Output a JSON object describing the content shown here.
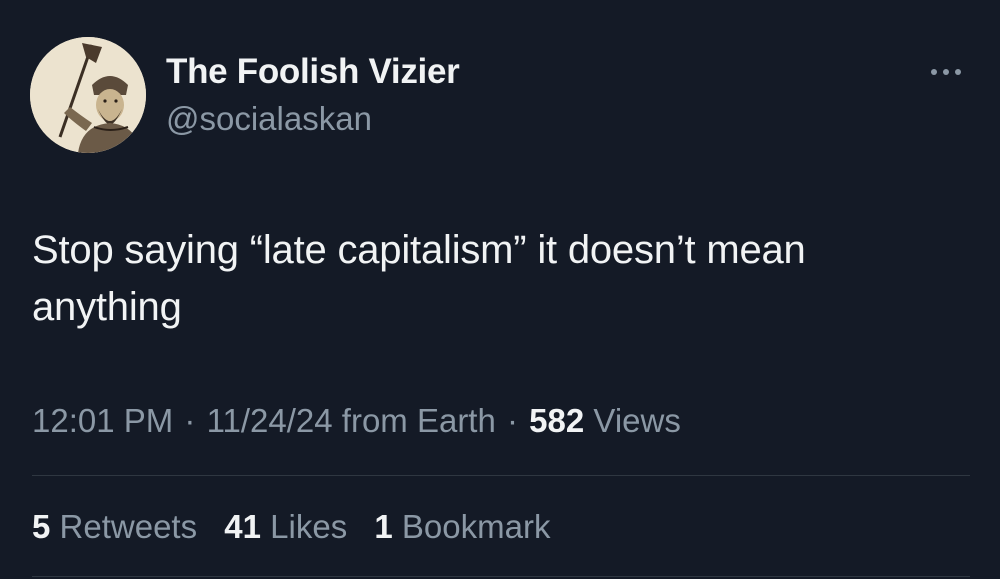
{
  "author": {
    "name": "The Foolish Vizier",
    "handle": "@socialaskan",
    "avatar_icon": "portrait-with-axe"
  },
  "more_icon": "more-horizontal-icon",
  "tweet": {
    "text": "Stop saying “late capitalism” it doesn’t mean anything"
  },
  "meta": {
    "time": "12:01 PM",
    "separator": "·",
    "date": "11/24/24",
    "source": "from Earth",
    "views_count": "582",
    "views_label": "Views"
  },
  "stats": {
    "retweets_count": "5",
    "retweets_label": "Retweets",
    "likes_count": "41",
    "likes_label": "Likes",
    "bookmarks_count": "1",
    "bookmarks_label": "Bookmark"
  },
  "colors": {
    "background": "#141a26",
    "primary_text": "#f1f3f4",
    "secondary_text": "#8b98a5",
    "divider": "#2f3741"
  }
}
